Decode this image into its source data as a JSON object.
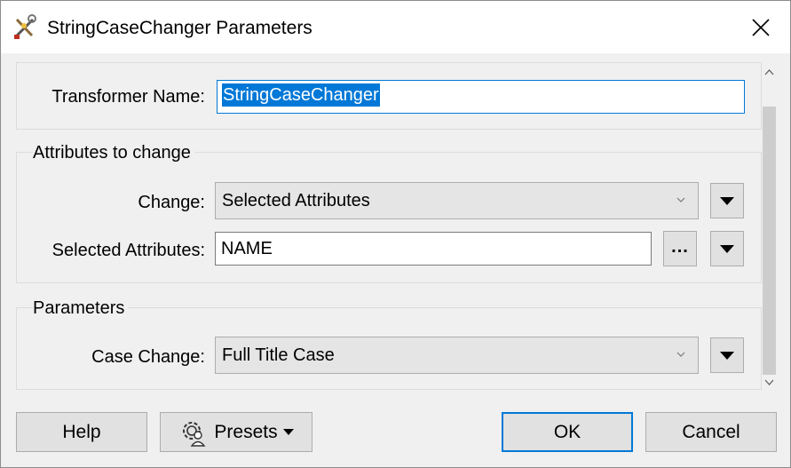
{
  "window": {
    "title": "StringCaseChanger Parameters",
    "app_icon": "transformer-tools-icon",
    "close_icon": "close-icon"
  },
  "transformer": {
    "label": "Transformer Name:",
    "value": "StringCaseChanger"
  },
  "attributes_group": {
    "legend": "Attributes to change",
    "change_label": "Change:",
    "change_value": "Selected Attributes",
    "selected_label": "Selected Attributes:",
    "selected_value": "NAME",
    "browse_label": "..."
  },
  "parameters_group": {
    "legend": "Parameters",
    "case_label": "Case Change:",
    "case_value": "Full Title Case"
  },
  "buttons": {
    "help": "Help",
    "presets": "Presets",
    "ok": "OK",
    "cancel": "Cancel"
  },
  "colors": {
    "accent": "#0078d7",
    "dialog_bg": "#f0f0f0",
    "button_bg": "#e1e1e1"
  }
}
